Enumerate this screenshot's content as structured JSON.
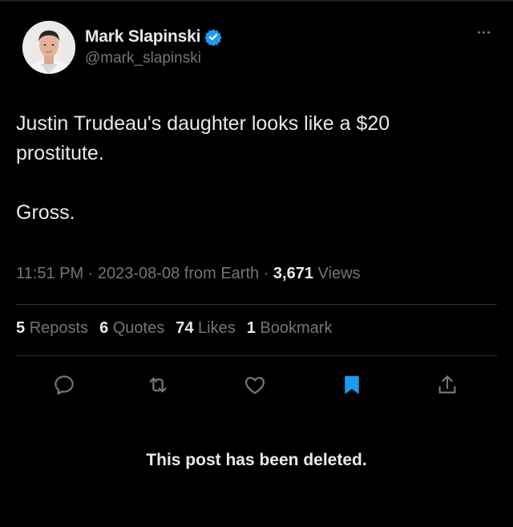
{
  "author": {
    "display_name": "Mark Slapinski",
    "handle": "@mark_slapinski",
    "verified_color": "#1d9bf0"
  },
  "tweet": {
    "text": "Justin Trudeau's daughter looks like a $20\nprostitute.\n\nGross."
  },
  "meta": {
    "time": "11:51 PM",
    "date": "2023-08-08",
    "source": "from Earth",
    "views_count": "3,671",
    "views_label": "Views"
  },
  "stats": {
    "reposts_count": "5",
    "reposts_label": "Reposts",
    "quotes_count": "6",
    "quotes_label": "Quotes",
    "likes_count": "74",
    "likes_label": "Likes",
    "bookmarks_count": "1",
    "bookmarks_label": "Bookmark"
  },
  "actions": {
    "reply_icon": "reply-icon",
    "repost_icon": "repost-icon",
    "like_icon": "heart-icon",
    "bookmark_icon": "bookmark-icon",
    "share_icon": "share-icon",
    "bookmark_color": "#1d9bf0"
  },
  "notice": {
    "text": "This post has been deleted."
  }
}
